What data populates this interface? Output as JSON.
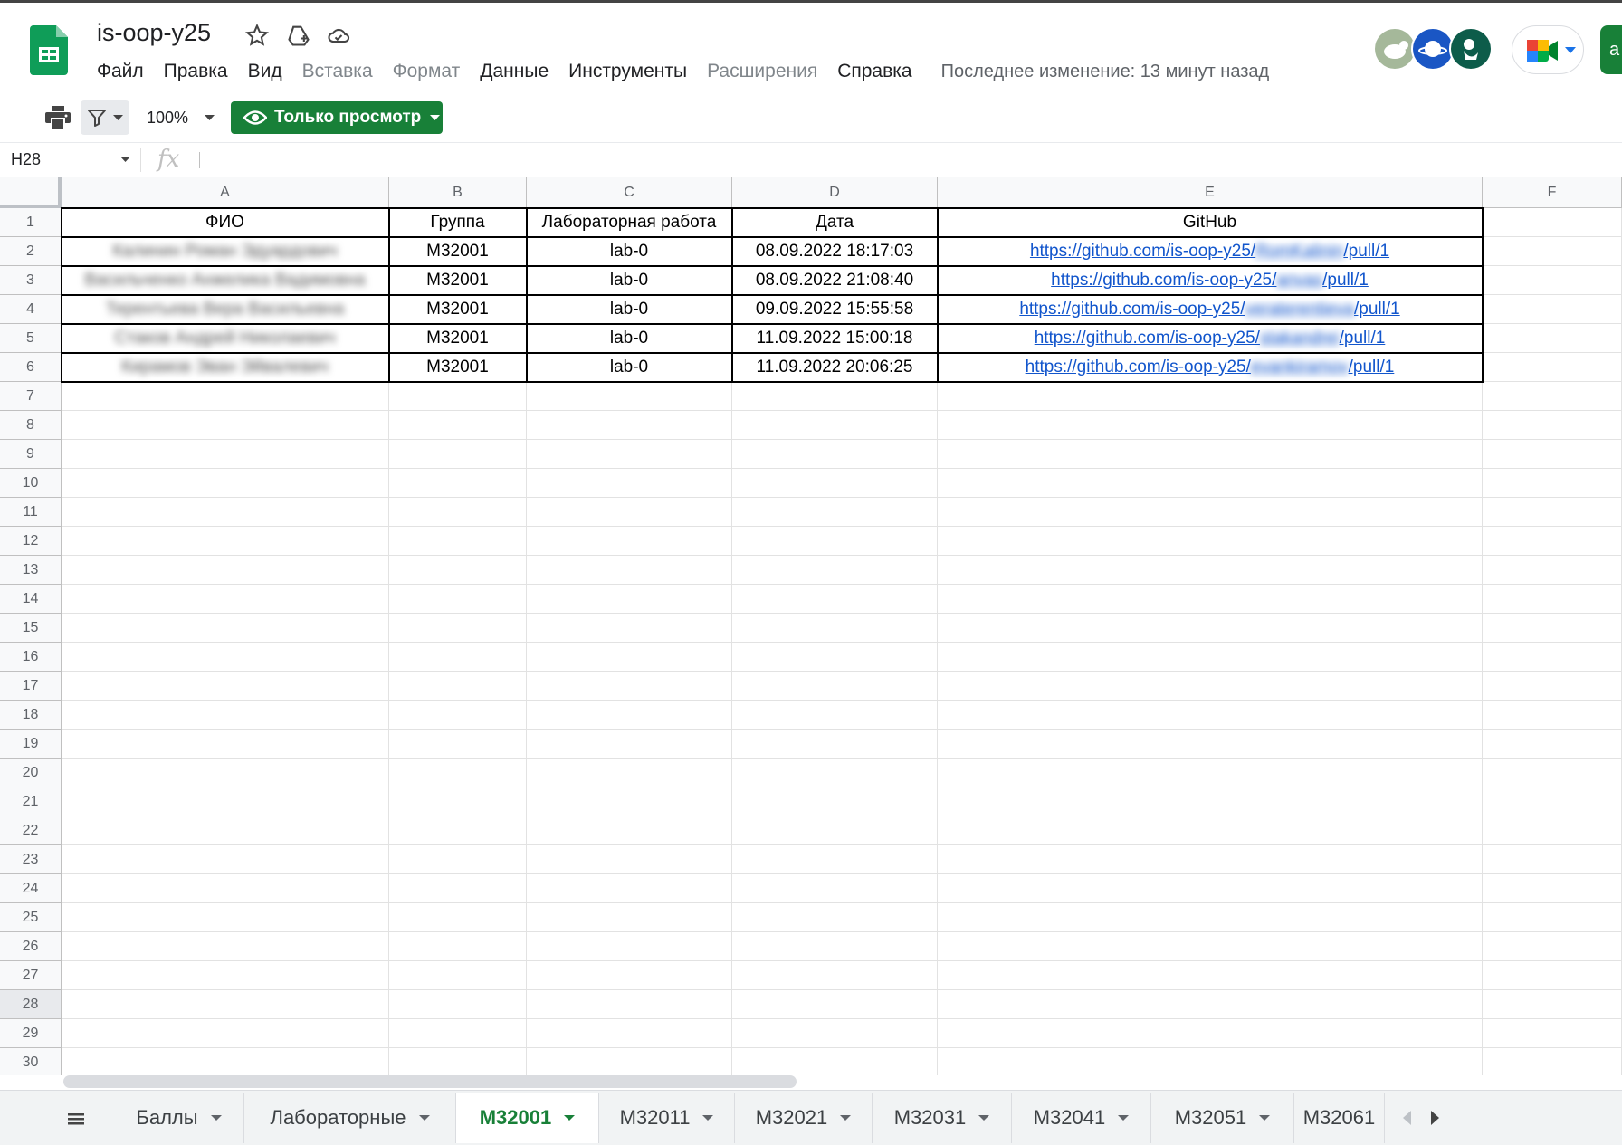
{
  "app": {
    "title": "is-oop-y25",
    "menu": [
      {
        "label": "Файл",
        "disabled": false
      },
      {
        "label": "Правка",
        "disabled": false
      },
      {
        "label": "Вид",
        "disabled": false
      },
      {
        "label": "Вставка",
        "disabled": true
      },
      {
        "label": "Формат",
        "disabled": true
      },
      {
        "label": "Данные",
        "disabled": false
      },
      {
        "label": "Инструменты",
        "disabled": false
      },
      {
        "label": "Расширения",
        "disabled": true
      },
      {
        "label": "Справка",
        "disabled": false
      }
    ],
    "last_edit": "Последнее изменение: 13 минут назад",
    "share_label": "a",
    "colors": {
      "brand_green": "#188038",
      "link": "#1155cc"
    }
  },
  "toolbar": {
    "zoom": "100%",
    "view_only_label": "Только просмотр"
  },
  "formula_bar": {
    "name_box": "H28",
    "fx": "fx"
  },
  "grid": {
    "columns": [
      "A",
      "B",
      "C",
      "D",
      "E",
      "F"
    ],
    "rows": [
      "1",
      "2",
      "3",
      "4",
      "5",
      "6",
      "7",
      "8",
      "9",
      "10",
      "11",
      "12",
      "13",
      "14",
      "15",
      "16",
      "17",
      "18",
      "19",
      "20",
      "21",
      "22",
      "23",
      "24",
      "25",
      "26",
      "27",
      "28",
      "29",
      "30"
    ],
    "selected_row": "28",
    "header": [
      "ФИО",
      "Группа",
      "Лабораторная работа",
      "Дата",
      "GitHub"
    ],
    "data": [
      {
        "name": "Калинин Роман Эдуардович",
        "group": "M32001",
        "lab": "lab-0",
        "date": "08.09.2022 18:17:03",
        "url_prefix": "https://github.com/is-oop-y25/",
        "url_hidden": "RomKalinin",
        "url_suffix": "/pull/1"
      },
      {
        "name": "Васильченко Анжелика Вадимовна",
        "group": "M32001",
        "lab": "lab-0",
        "date": "08.09.2022 21:08:40",
        "url_prefix": "https://github.com/is-oop-y25/",
        "url_hidden": "anvas",
        "url_suffix": "/pull/1"
      },
      {
        "name": "Терентьева Вера Васильевна",
        "group": "M32001",
        "lab": "lab-0",
        "date": "09.09.2022 15:55:58",
        "url_prefix": "https://github.com/is-oop-y25/",
        "url_hidden": "veraterentieva",
        "url_suffix": "/pull/1"
      },
      {
        "name": "Стаков Андрей Николаевич",
        "group": "M32001",
        "lab": "lab-0",
        "date": "11.09.2022 15:00:18",
        "url_prefix": "https://github.com/is-oop-y25/",
        "url_hidden": "stakandrei",
        "url_suffix": "/pull/1"
      },
      {
        "name": "Кирамов Эван Эйвалевич",
        "group": "M32001",
        "lab": "lab-0",
        "date": "11.09.2022 20:06:25",
        "url_prefix": "https://github.com/is-oop-y25/",
        "url_hidden": "evankiramov",
        "url_suffix": "/pull/1"
      }
    ]
  },
  "sheets": {
    "tabs": [
      {
        "label": "Баллы",
        "active": false
      },
      {
        "label": "Лабораторные",
        "active": false
      },
      {
        "label": "M32001",
        "active": true
      },
      {
        "label": "M32011",
        "active": false
      },
      {
        "label": "M32021",
        "active": false
      },
      {
        "label": "M32031",
        "active": false
      },
      {
        "label": "M32041",
        "active": false
      },
      {
        "label": "M32051",
        "active": false
      },
      {
        "label": "M32061",
        "active": false
      }
    ]
  }
}
